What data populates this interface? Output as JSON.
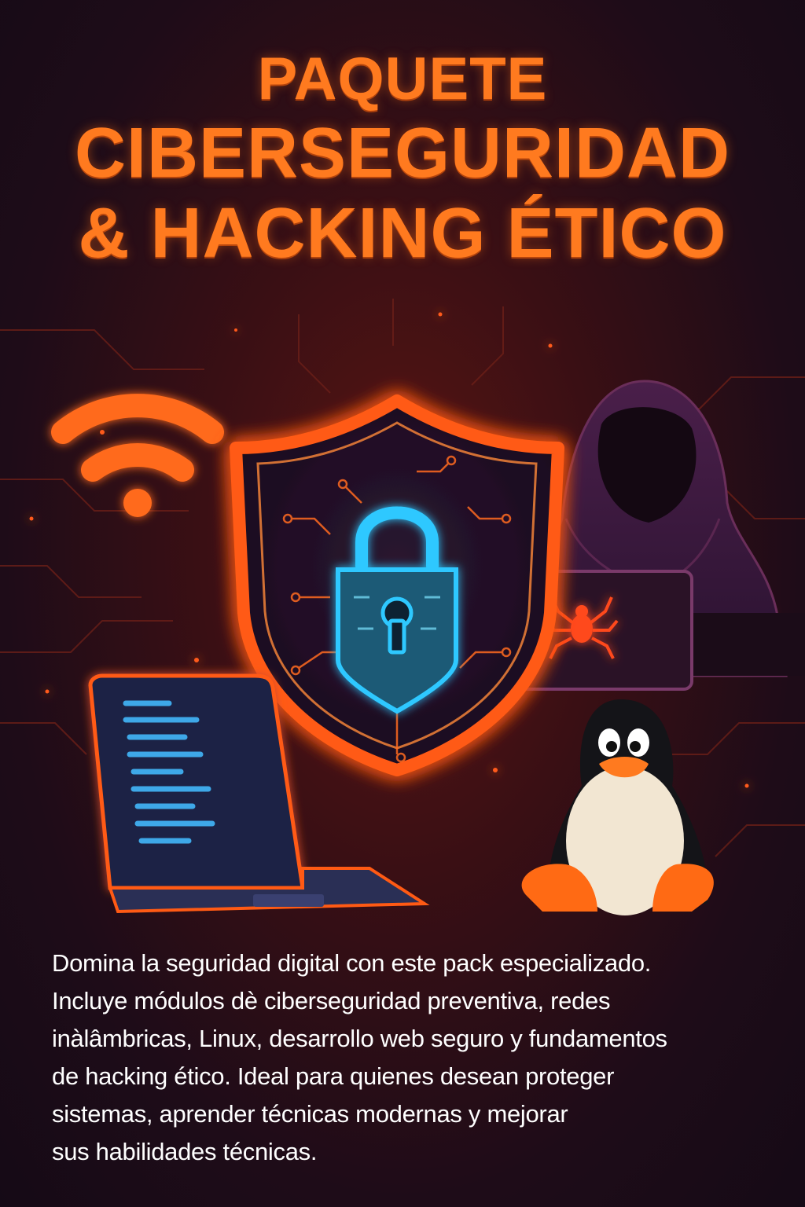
{
  "title": {
    "line1": "PAQUETE",
    "line2": "CIBERSEGURIDAD",
    "line3": "& HACKING ÉTICO"
  },
  "description": {
    "lines": [
      " Domina la seguridad digital con este pack especializado.",
      "Incluye módulos dè ciberseguridad preventiva, redes",
      "inàlâmbricas, Linux, desarrollo web seguro y fundamentos",
      "de hacking ético. Ideal para quienes desean proteger",
      "sistemas, aprender técnicas modernas y mejorar",
      "sus habilidades técnicas."
    ]
  },
  "icons": [
    "wifi-icon",
    "shield-icon",
    "padlock-icon",
    "hooded-hacker-figure",
    "spider-icon",
    "laptop-icon",
    "linux-penguin-icon"
  ],
  "colors": {
    "accent": "#ff7a1f",
    "neon_blue": "#2ec8ff",
    "background": "#1e0c18",
    "text": "#ffffff"
  }
}
